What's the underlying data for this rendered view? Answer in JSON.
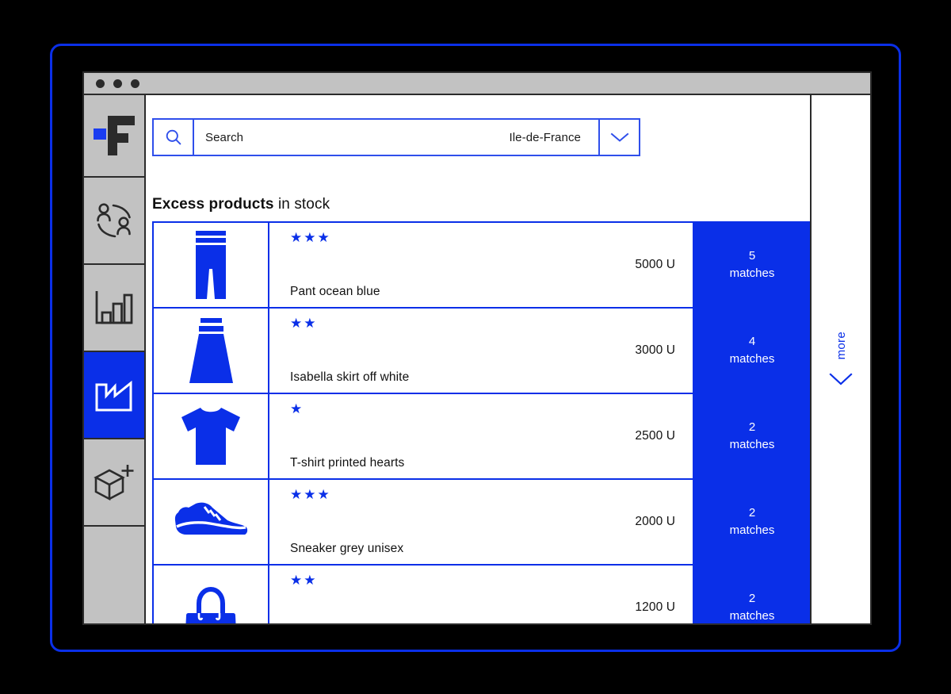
{
  "theme": {
    "accent_blue": "#0A2FE8",
    "frame_blue": "#0A2FE8",
    "sidebar_grey": "#C2C2C2",
    "outline_dark": "#2B2B2B",
    "page_background": "#000000",
    "panel_white": "#FFFFFF"
  },
  "window": {
    "titlebar_dots": [
      "dot-1",
      "dot-2",
      "dot-3"
    ]
  },
  "sidebar": {
    "items": [
      {
        "id": "logo",
        "icon": "logo-f-icon",
        "label": "Logo",
        "active": false
      },
      {
        "id": "community",
        "icon": "people-network-icon",
        "label": "Community",
        "active": false
      },
      {
        "id": "analytics",
        "icon": "bar-chart-icon",
        "label": "Analytics",
        "active": false
      },
      {
        "id": "factory",
        "icon": "factory-icon",
        "label": "Production",
        "active": true
      },
      {
        "id": "add-item",
        "icon": "box-plus-icon",
        "label": "Add product",
        "active": false
      }
    ]
  },
  "search": {
    "icon": "search-icon",
    "placeholder": "Search",
    "value": "",
    "region_value": "Ile-de-France",
    "dropdown_icon": "chevron-down-icon"
  },
  "main": {
    "title_bold": "Excess products",
    "title_light": " in stock",
    "columns": [
      "thumbnail",
      "rating",
      "product",
      "quantity",
      "matches"
    ]
  },
  "products": [
    {
      "icon": "pants-icon",
      "stars": 3,
      "stars_glyphs": "★★★",
      "name": "Pant ocean blue",
      "quantity": "5000 U",
      "matches_count": "5",
      "matches_label": "matches"
    },
    {
      "icon": "skirt-icon",
      "stars": 2,
      "stars_glyphs": "★★",
      "name": "Isabella skirt off white",
      "quantity": "3000 U",
      "matches_count": "4",
      "matches_label": "matches"
    },
    {
      "icon": "tshirt-icon",
      "stars": 1,
      "stars_glyphs": "★",
      "name": "T-shirt printed hearts",
      "quantity": "2500 U",
      "matches_count": "2",
      "matches_label": "matches"
    },
    {
      "icon": "sneaker-icon",
      "stars": 3,
      "stars_glyphs": "★★★",
      "name": "Sneaker grey unisex",
      "quantity": "2000 U",
      "matches_count": "2",
      "matches_label": "matches"
    },
    {
      "icon": "handbag-icon",
      "stars": 2,
      "stars_glyphs": "★★",
      "name": "",
      "quantity": "1200 U",
      "matches_count": "2",
      "matches_label": "matches"
    }
  ],
  "more": {
    "label": "more",
    "icon": "chevron-down-icon"
  }
}
